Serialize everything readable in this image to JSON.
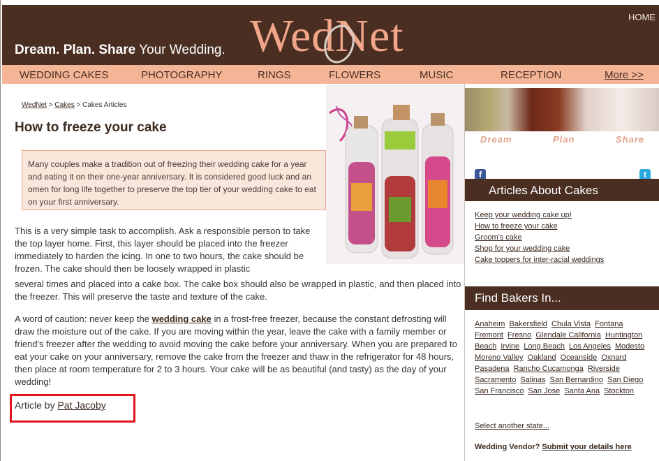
{
  "header": {
    "tagline_bold": "Dream. Plan. Share",
    "tagline_rest": " Your Wedding.",
    "logo": "WedNet",
    "home_link": "HOME"
  },
  "nav": {
    "items": [
      "WEDDING CAKES",
      "PHOTOGRAPHY",
      "RINGS",
      "FLOWERS",
      "MUSIC",
      "RECEPTION"
    ],
    "more": "More >>"
  },
  "breadcrumb": {
    "home": "WedNet",
    "sep1": " > ",
    "cakes": "Cakes",
    "sep2": " > ",
    "current": "Cakes Articles"
  },
  "article": {
    "title": "How to freeze your cake",
    "intro": "Many couples make a tradition out of freezing their wedding cake for a year and eating it on their one-year anniversary. It is considered good luck and an omen for long life together to preserve the top tier of your wedding cake to eat on your first anniversary.",
    "para1_a": "This is a very simple task to accomplish. Ask a responsible person to take the top layer home. First, this layer should be placed into the freezer immediately to harden the icing. In one to two hours, the cake should be frozen. The cake should then be loosely wrapped in plastic",
    "para1_b": "several times and placed into a cake box. The cake box should also be wrapped in plastic, and then placed into the freezer. This will preserve the taste and texture of the cake.",
    "para2_pre": "A word of caution: never keep the ",
    "para2_link": "wedding cake",
    "para2_post": " in a frost-free freezer, because the constant defrosting will draw the moisture out of the cake. If you are moving within the year, leave the cake with a family member or friend's freezer after the wedding to avoid moving the cake before your anniversary. When you are prepared to eat your cake on your anniversary, remove the cake from the freezer and thaw in the refrigerator for 48 hours, then place at room temperature for 2 to 3 hours. Your cake will be as beautiful (and tasty) as the day of your wedding!",
    "byline_prefix": "Article by ",
    "author": "Pat Jacoby"
  },
  "sidebar": {
    "photo_words": [
      "Dream",
      "Plan",
      "Share"
    ],
    "facebook_glyph": "f",
    "twitter_glyph": "t",
    "articles_heading": "Articles About Cakes",
    "articles": [
      "Keep your wedding cake up!",
      "How to freeze your cake",
      "Groom's cake",
      "Shop for your wedding cake",
      "Cake toppers for inter-racial weddings"
    ],
    "bakers_heading": "Find Bakers In...",
    "cities": [
      "Anaheim",
      "Bakersfield",
      "Chula Vista",
      "Fontana",
      "Fremont",
      "Fresno",
      "Glendale California",
      "Huntington Beach",
      "Irvine",
      "Long Beach",
      "Los Angeles",
      "Modesto",
      "Moreno Valley",
      "Oakland",
      "Oceanside",
      "Oxnard",
      "Pasadena",
      "Rancho Cucamonga",
      "Riverside",
      "Sacramento",
      "Salinas",
      "San Bernardino",
      "San Diego",
      "San Francisco",
      "San Jose",
      "Santa Ana",
      "Stockton"
    ],
    "select_state": "Select another state...",
    "vendor_prefix": "Wedding Vendor? ",
    "vendor_link": "Submit your details here"
  },
  "colors": {
    "header_bg": "#4a2e22",
    "nav_bg": "#f4b597",
    "logo": "#f1a68a",
    "highlight_box": "#e0141a"
  }
}
